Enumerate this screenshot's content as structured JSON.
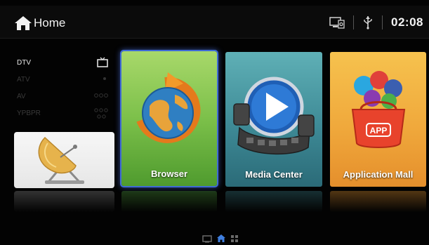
{
  "header": {
    "title": "Home",
    "clock": "02:08"
  },
  "sources": [
    {
      "label": "DTV",
      "icon": "tv-icon",
      "active": true
    },
    {
      "label": "ATV",
      "icon": "dot-icon",
      "active": false
    },
    {
      "label": "AV",
      "icon": "av-ports-icon",
      "active": false
    },
    {
      "label": "YPBPR",
      "icon": "component-ports-icon",
      "active": false
    }
  ],
  "tiles": [
    {
      "label": "Browser",
      "icon": "globe-icon"
    },
    {
      "label": "Media Center",
      "icon": "play-film-icon"
    },
    {
      "label": "Application Mall",
      "icon": "app-store-icon"
    }
  ],
  "colors": {
    "focus": "#3f6ad6",
    "browser": "#7cc04a",
    "media": "#3e8a96",
    "app": "#f0a93c"
  },
  "pager": {
    "pages": [
      "tv-page-icon",
      "home-page-icon",
      "grid-page-icon"
    ],
    "current": 1
  }
}
